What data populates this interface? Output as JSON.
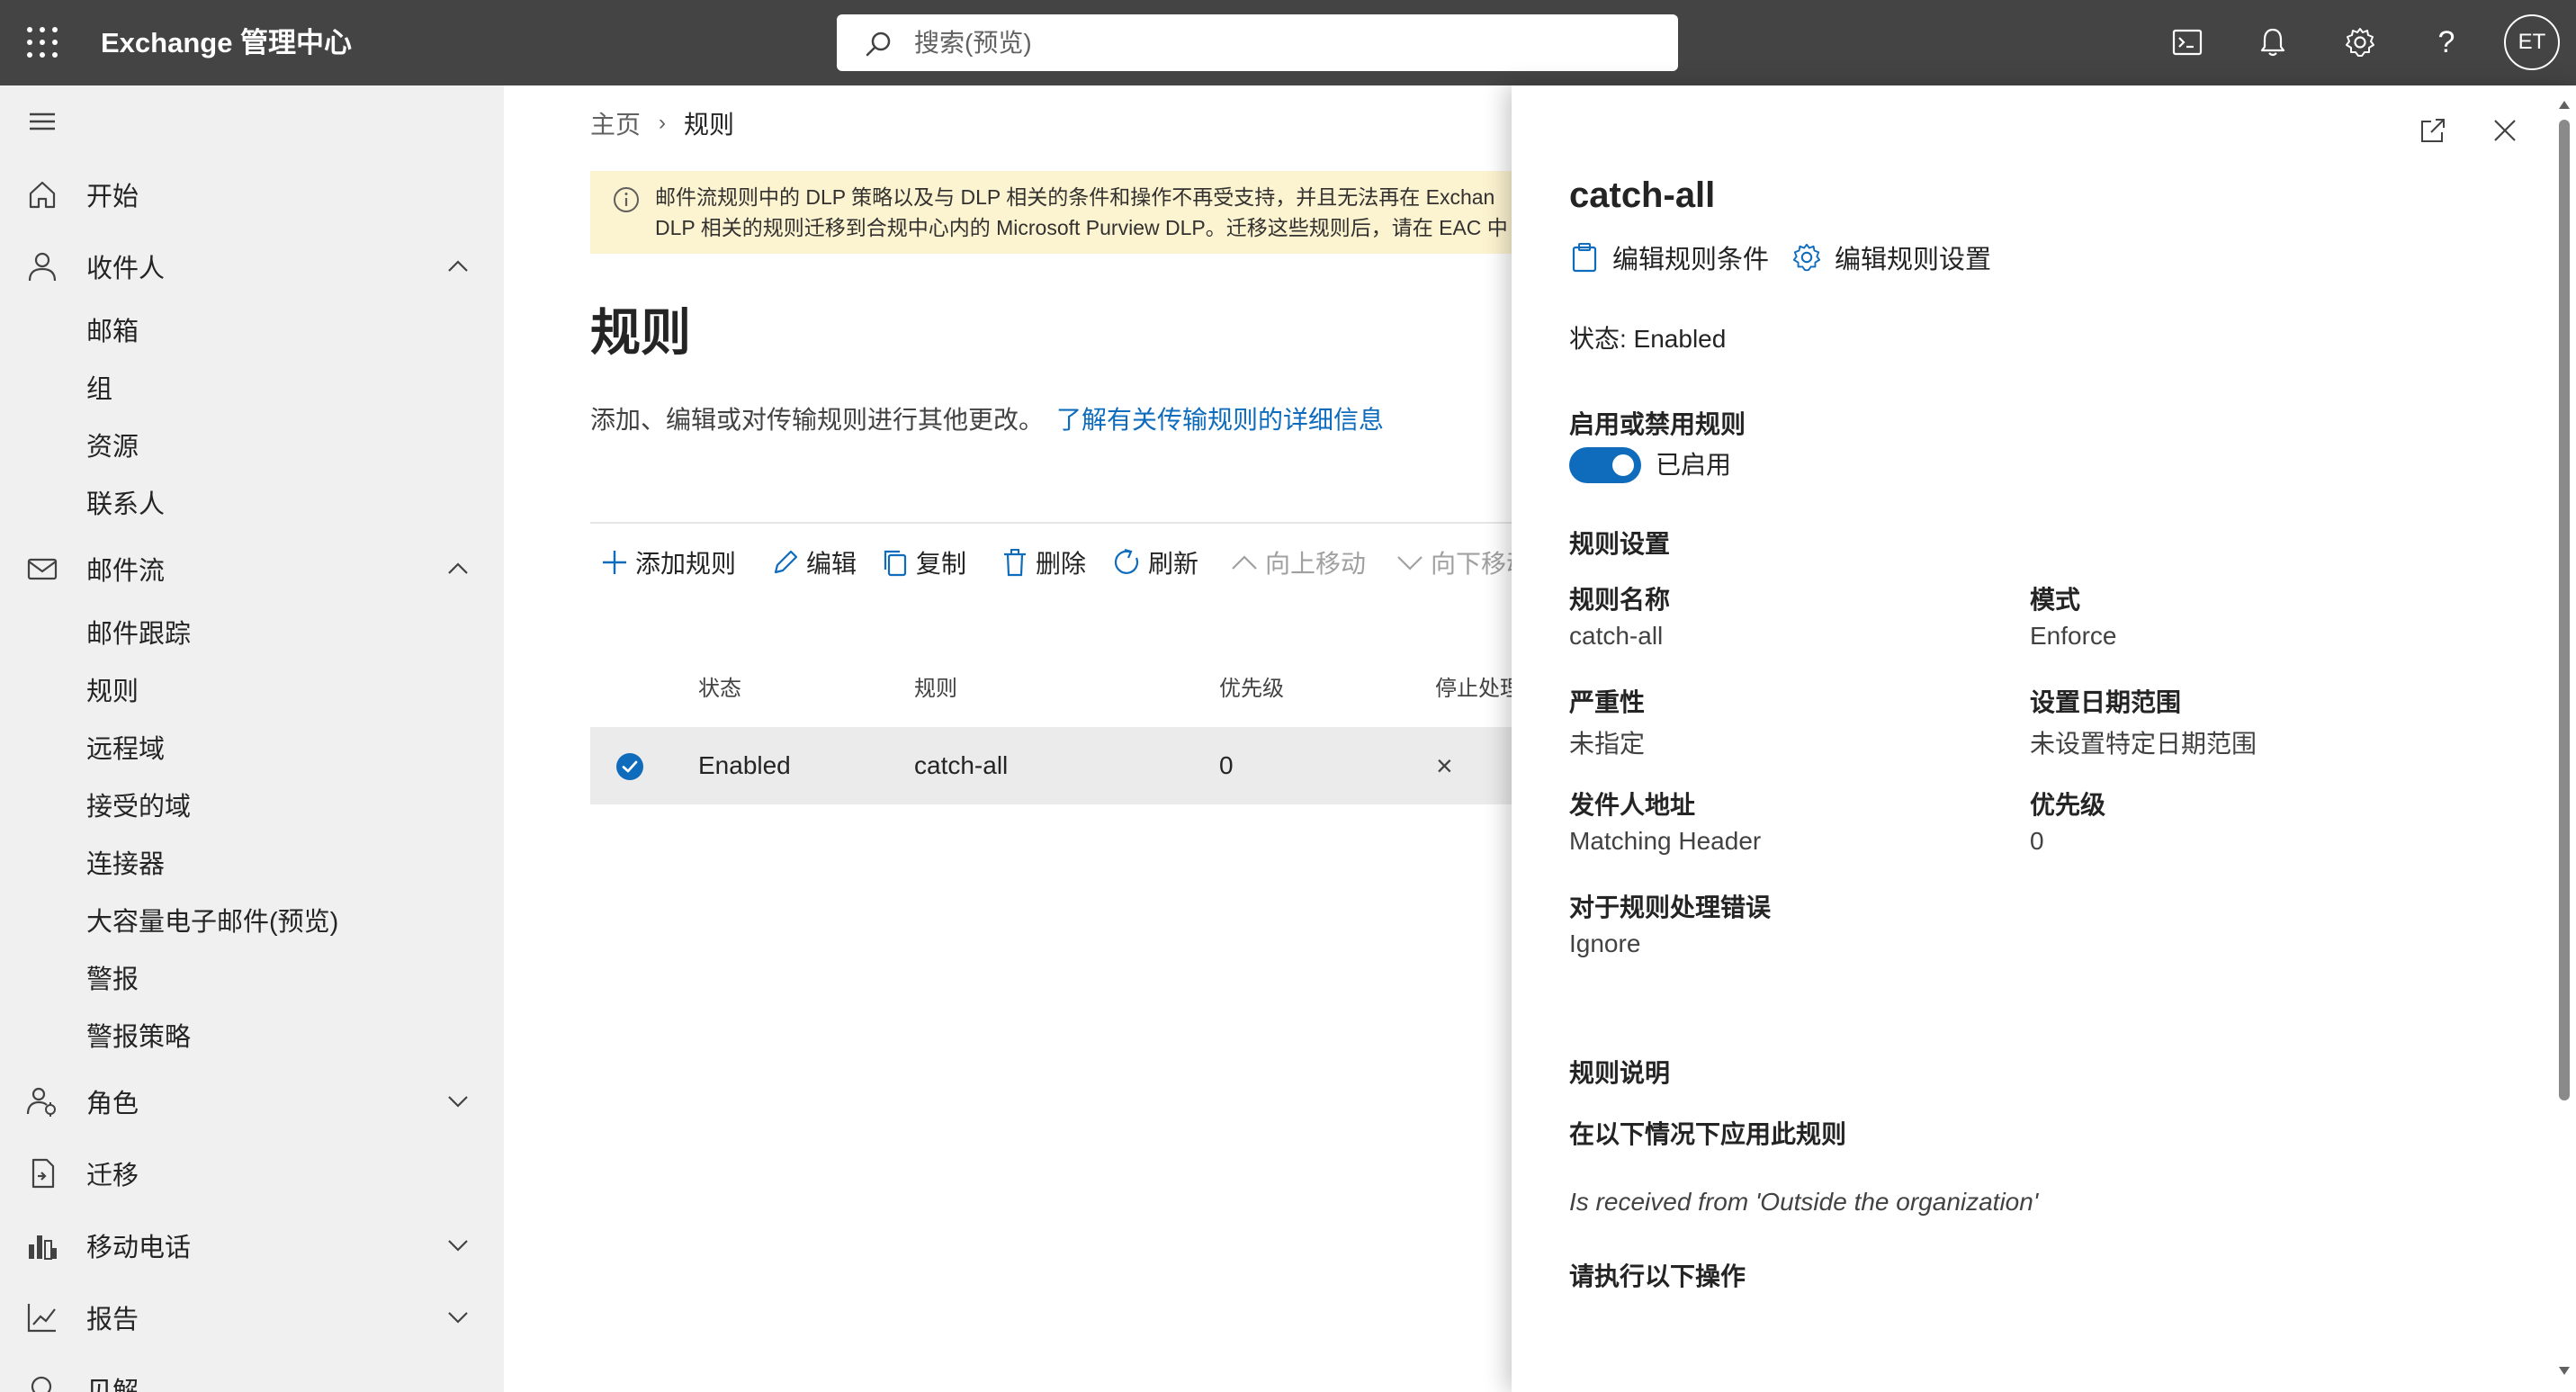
{
  "topbar": {
    "app_title": "Exchange 管理中心",
    "search_placeholder": "搜索(预览)",
    "user_initials": "ET"
  },
  "sidebar": {
    "items": [
      {
        "label": "开始",
        "icon": "home-icon"
      },
      {
        "label": "收件人",
        "icon": "person-icon",
        "expanded": true,
        "children": [
          "邮箱",
          "组",
          "资源",
          "联系人"
        ]
      },
      {
        "label": "邮件流",
        "icon": "mail-icon",
        "expanded": true,
        "children": [
          "邮件跟踪",
          "规则",
          "远程域",
          "接受的域",
          "连接器",
          "大容量电子邮件(预览)",
          "警报",
          "警报策略"
        ]
      },
      {
        "label": "角色",
        "icon": "roles-icon",
        "expanded": false
      },
      {
        "label": "迁移",
        "icon": "migration-icon"
      },
      {
        "label": "移动电话",
        "icon": "mobile-icon",
        "expanded": false
      },
      {
        "label": "报告",
        "icon": "reports-icon",
        "expanded": false
      },
      {
        "label": "见解",
        "icon": "insights-icon"
      }
    ]
  },
  "main": {
    "breadcrumb": {
      "home": "主页",
      "current": "规则"
    },
    "banner": {
      "line1": "邮件流规则中的 DLP 策略以及与 DLP 相关的条件和操作不再受支持，并且无法再在 Exchan",
      "line2": "DLP 相关的规则迁移到合规中心内的 Microsoft Purview DLP。迁移这些规则后，请在 EAC 中"
    },
    "title": "规则",
    "description": "添加、编辑或对传输规则进行其他更改。",
    "learn_more": "了解有关传输规则的详细信息",
    "toolbar": {
      "add": "添加规则",
      "edit": "编辑",
      "copy": "复制",
      "delete": "删除",
      "refresh": "刷新",
      "move_up": "向上移动",
      "move_down": "向下移动"
    },
    "table": {
      "headers": {
        "status": "状态",
        "rule": "规则",
        "priority": "优先级",
        "stop": "停止处理"
      },
      "rows": [
        {
          "status": "Enabled",
          "rule": "catch-all",
          "priority": "0",
          "stop": "×",
          "selected": true
        }
      ]
    }
  },
  "panel": {
    "title": "catch-all",
    "edit_conditions": "编辑规则条件",
    "edit_settings": "编辑规则设置",
    "status": "状态: Enabled",
    "toggle_section": "启用或禁用规则",
    "toggle_label": "已启用",
    "toggle_on": true,
    "settings_heading": "规则设置",
    "fields": {
      "name_label": "规则名称",
      "name_value": "catch-all",
      "mode_label": "模式",
      "mode_value": "Enforce",
      "severity_label": "严重性",
      "severity_value": "未指定",
      "date_label": "设置日期范围",
      "date_value": "未设置特定日期范围",
      "sender_label": "发件人地址",
      "sender_value": "Matching Header",
      "priority_label": "优先级",
      "priority_value": "0",
      "error_label": "对于规则处理错误",
      "error_value": "Ignore"
    },
    "description_heading": "规则说明",
    "apply_heading": "在以下情况下应用此规则",
    "condition": "Is received from 'Outside the organization'",
    "actions_heading": "请执行以下操作"
  },
  "colors": {
    "topbar": "#444444",
    "accent": "#0f6cbd",
    "banner": "#fcf3d0",
    "sidebar": "#f0f0f0"
  }
}
